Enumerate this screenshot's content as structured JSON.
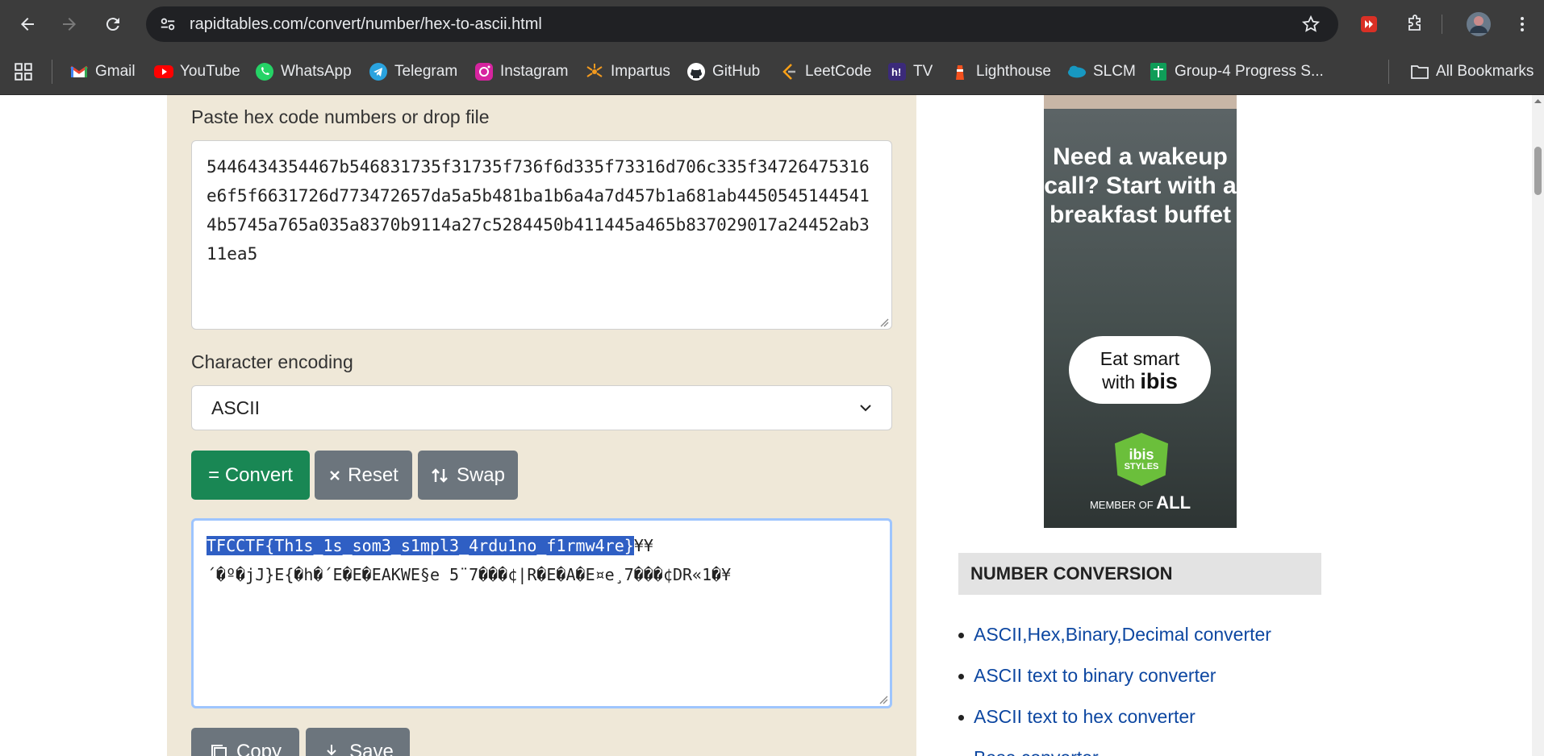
{
  "browser": {
    "url": "rapidtables.com/convert/number/hex-to-ascii.html",
    "bookmarks": [
      {
        "label": "Gmail",
        "icon": "gmail-icon"
      },
      {
        "label": "YouTube",
        "icon": "youtube-icon"
      },
      {
        "label": "WhatsApp",
        "icon": "whatsapp-icon"
      },
      {
        "label": "Telegram",
        "icon": "telegram-icon"
      },
      {
        "label": "Instagram",
        "icon": "instagram-icon"
      },
      {
        "label": "Impartus",
        "icon": "impartus-icon"
      },
      {
        "label": "GitHub",
        "icon": "github-icon"
      },
      {
        "label": "LeetCode",
        "icon": "leetcode-icon"
      },
      {
        "label": "TV",
        "icon": "tv-icon"
      },
      {
        "label": "Lighthouse",
        "icon": "lighthouse-icon"
      },
      {
        "label": "SLCM",
        "icon": "slcm-icon"
      },
      {
        "label": "Group-4 Progress S...",
        "icon": "sheets-icon"
      }
    ],
    "all_bookmarks": "All Bookmarks"
  },
  "converter": {
    "hex_label": "Paste hex code numbers or drop file",
    "hex_value": "5446434354467b546831735f31735f736f6d335f73316d706c335f34726475316e6f5f6631726d773472657da5a5b481ba1b6a4a7d457b1a681ab44505451445414b5745a765a035a8370b9114a27c5284450b411445a465b837029017a24452ab311ea5",
    "encoding_label": "Character encoding",
    "encoding_value": "ASCII",
    "convert_label": "= Convert",
    "reset_label": "Reset",
    "swap_label": "Swap",
    "output_selected": "TFCCTF{Th1s_1s_som3_s1mpl3_4rdu1no_f1rmw4re}",
    "output_rest_line1": "¥¥",
    "output_line2": "´�º�jJ}E{�h�´E�E�EAKWE§e 5¨7���¢|R�E�A�E¤e¸7���¢DR«1�¥",
    "copy_label": "Copy",
    "save_label": "Save"
  },
  "ad": {
    "headline": "Need a wakeup call? Start with a breakfast buffet",
    "pill_line1": "Eat smart",
    "pill_line2_prefix": "with ",
    "pill_brand": "ibis",
    "logo_line1": "ibis",
    "logo_line2": "STYLES",
    "member_prefix": "MEMBER OF ",
    "member_brand": "ALL"
  },
  "sidebar": {
    "heading": "NUMBER CONVERSION",
    "links": [
      "ASCII,Hex,Binary,Decimal converter",
      "ASCII text to binary converter",
      "ASCII text to hex converter",
      "Base converter"
    ]
  },
  "colors": {
    "convert": "#198754",
    "secondary": "#6c757d",
    "panel_bg": "#efe8d8",
    "link": "#0d47a1",
    "selection": "#2f5fc4"
  }
}
